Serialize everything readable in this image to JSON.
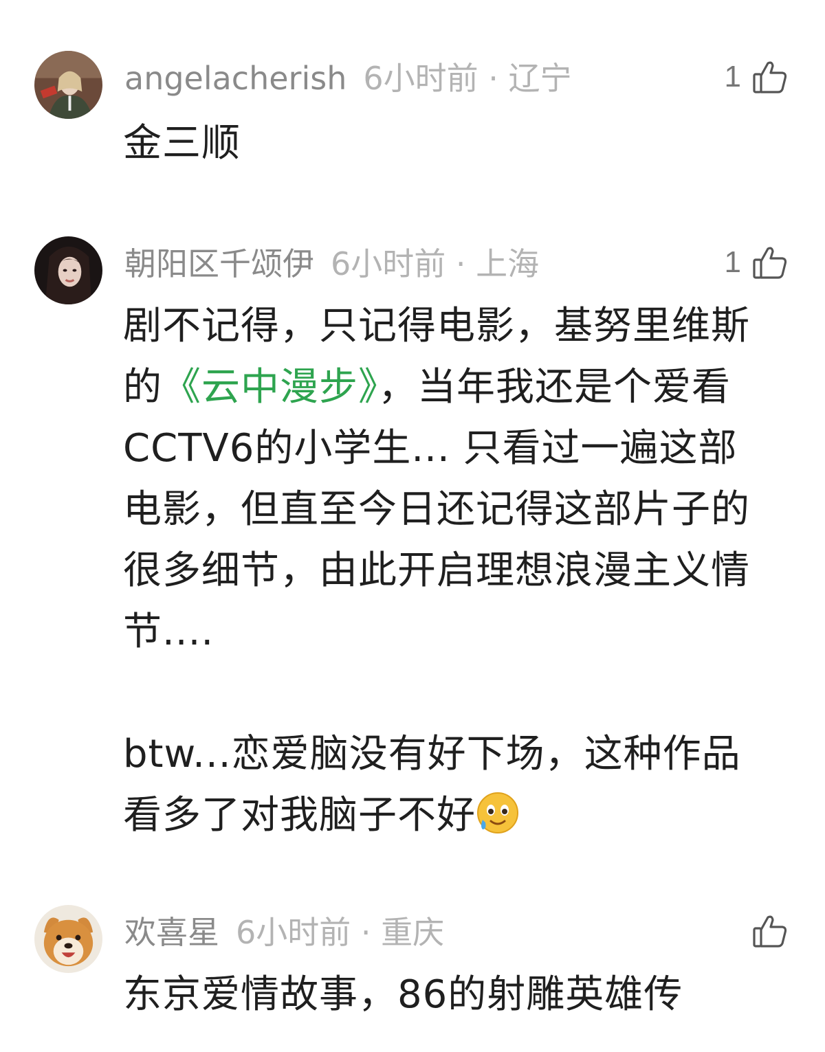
{
  "comments": [
    {
      "username": "angelacherish",
      "time": "6小时前",
      "location": "辽宁",
      "likes": "1",
      "text": "金三顺"
    },
    {
      "username": "朝阳区千颂伊",
      "time": "6小时前",
      "location": "上海",
      "likes": "1",
      "text_part1": "剧不记得，只记得电影，基努里维斯的",
      "link_text": "《云中漫步》",
      "text_part2": "，当年我还是个爱看CCTV6的小学生... 只看过一遍这部电影，但直至今日还记得这部片子的很多细节，由此开启理想浪漫主义情节....",
      "text_para2": "btw...恋爱脑没有好下场，这种作品看多了对我脑子不好",
      "emoji": "crying-smile-emoji"
    },
    {
      "username": "欢喜星",
      "time": "6小时前",
      "location": "重庆",
      "likes": "",
      "text": "东京爱情故事，86的射雕英雄传"
    }
  ],
  "separator": "·",
  "colors": {
    "username": "#8a8a8a",
    "meta": "#b3b3b3",
    "link": "#2ea44f",
    "text": "#1f1f1f"
  }
}
